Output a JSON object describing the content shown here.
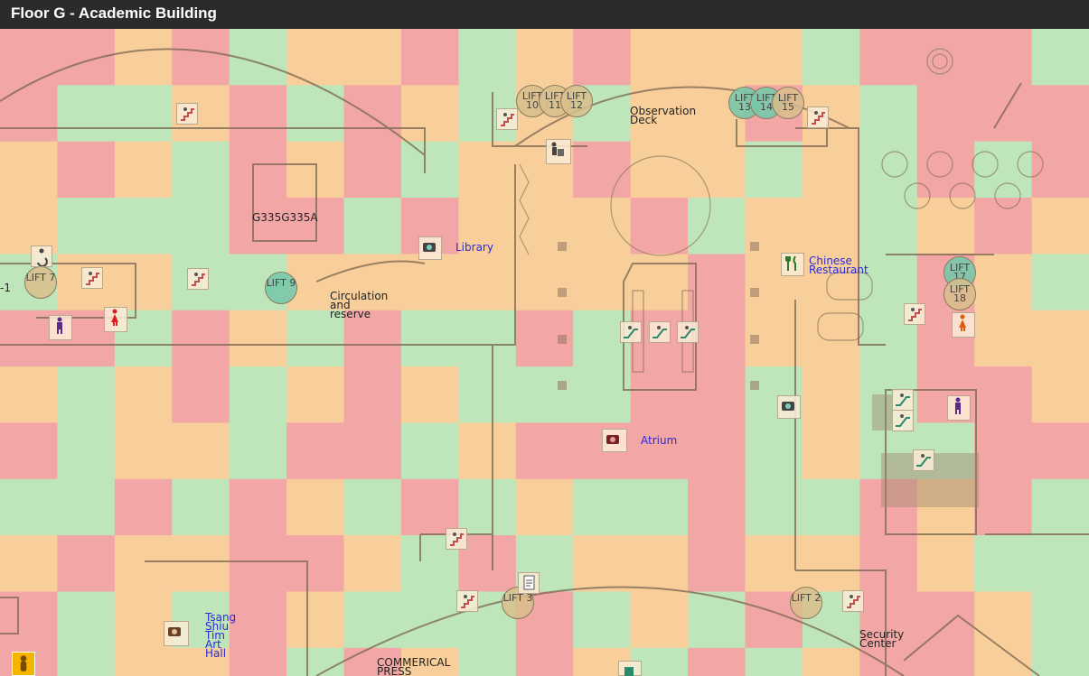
{
  "title": "Floor G - Academic Building",
  "heat_colors": {
    "red": "#f3a6a6",
    "orange": "#f8cf9a",
    "green": "#bfe6bb"
  },
  "rooms": {
    "observation": "Observation\nDeck",
    "g335": "G335G335A",
    "library": "Library",
    "circulation": "Circulation\nand\nreserve",
    "chinese": "Chinese\nRestaurant",
    "atrium": "Atrium",
    "tsang": "Tsang\nShiu\nTim\nArt\nHall",
    "press": "COMMERICAL\nPRESS",
    "security": "Security\nCenter",
    "edge": "-1"
  },
  "lifts": {
    "l7": "LIFT\n7",
    "l9": "LIFT\n9",
    "l10": "LIFT\n10",
    "l11": "LIFT\n11",
    "l12": "LIFT\n12",
    "l13": "LIFT\n13",
    "l14": "LIFT\n14",
    "l15": "LIFT\n15",
    "l17": "LIFT\n17",
    "l18": "LIFT\n18",
    "l3": "LIFT\n3",
    "l2": "LIFT\n2"
  }
}
